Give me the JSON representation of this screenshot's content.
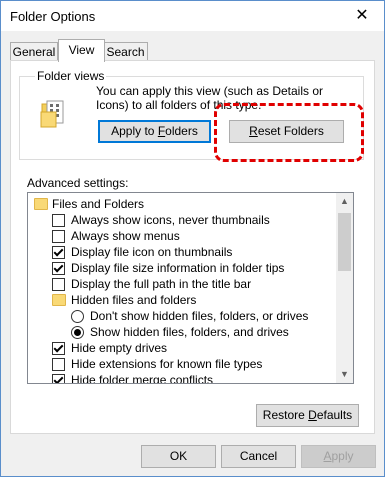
{
  "window": {
    "title": "Folder Options",
    "close_glyph": "✕"
  },
  "tabs": [
    {
      "label": "General"
    },
    {
      "label": "View"
    },
    {
      "label": "Search"
    }
  ],
  "folder_views": {
    "group_label": "Folder views",
    "description": "You can apply this view (such as Details or Icons) to all folders of this type.",
    "icon": "folder-views-icon",
    "apply_button": {
      "pre": "Apply to ",
      "underlined": "F",
      "post": "olders"
    },
    "reset_button": {
      "pre": "",
      "underlined": "R",
      "post": "eset Folders"
    }
  },
  "advanced": {
    "label": "Advanced settings:",
    "items": [
      {
        "kind": "folder",
        "label": "Files and Folders"
      },
      {
        "kind": "checkbox",
        "checked": false,
        "label": "Always show icons, never thumbnails"
      },
      {
        "kind": "checkbox",
        "checked": false,
        "label": "Always show menus"
      },
      {
        "kind": "checkbox",
        "checked": true,
        "label": "Display file icon on thumbnails"
      },
      {
        "kind": "checkbox",
        "checked": true,
        "label": "Display file size information in folder tips"
      },
      {
        "kind": "checkbox",
        "checked": false,
        "label": "Display the full path in the title bar"
      },
      {
        "kind": "folder",
        "label": "Hidden files and folders"
      },
      {
        "kind": "radio",
        "selected": false,
        "label": "Don't show hidden files, folders, or drives"
      },
      {
        "kind": "radio",
        "selected": true,
        "label": "Show hidden files, folders, and drives"
      },
      {
        "kind": "checkbox",
        "checked": true,
        "label": "Hide empty drives"
      },
      {
        "kind": "checkbox",
        "checked": false,
        "label": "Hide extensions for known file types"
      },
      {
        "kind": "checkbox",
        "checked": true,
        "label": "Hide folder merge conflicts"
      }
    ],
    "restore_button": {
      "pre": "Restore ",
      "underlined": "D",
      "post": "efaults"
    }
  },
  "footer": {
    "ok": "OK",
    "cancel": "Cancel",
    "apply": {
      "pre": "",
      "underlined": "A",
      "post": "pply"
    }
  },
  "colors": {
    "annotation": "#e00000",
    "accent": "#0078d7",
    "window_border": "#5a8ecb"
  }
}
